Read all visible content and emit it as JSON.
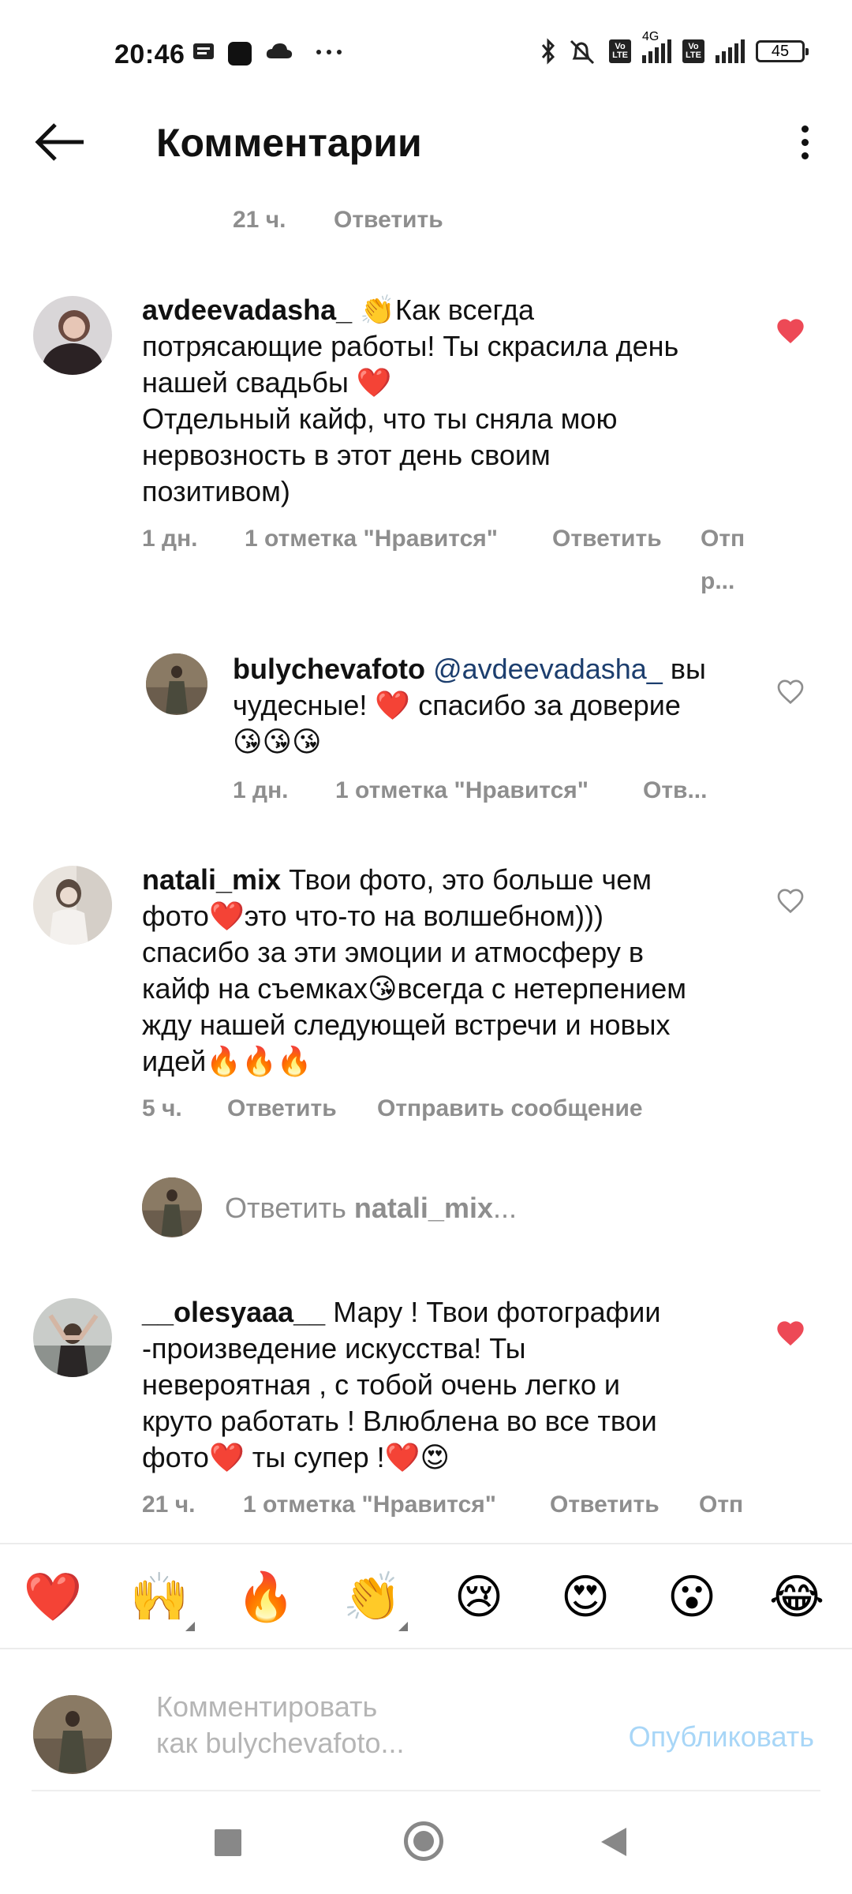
{
  "status_bar": {
    "time": "20:46",
    "battery": "45",
    "network": "4G"
  },
  "header": {
    "title": "Комментарии"
  },
  "top_meta": {
    "time": "21 ч.",
    "reply": "Ответить"
  },
  "comments": [
    {
      "username": "avdeevadasha_",
      "text": "👏Как всегда потрясающие работы! Ты скрасила день нашей свадьбы ❤️ Отдельный кайф, что ты сняла мою нервозность в этот день своим позитивом)",
      "line1": "👏Как всегда",
      "line2": "потрясающие работы! Ты скрасила день",
      "line3": "нашей свадьбы ❤️",
      "line4": "Отдельный кайф, что ты сняла мою",
      "line5": "нервозность в этот день своим",
      "line6": "позитивом)",
      "time": "1 дн.",
      "likes": "1 отметка \"Нравится\"",
      "reply": "Ответить",
      "extra_1": "Отп",
      "extra_2": "р...",
      "liked": true
    },
    {
      "username": "bulychevafoto",
      "mention": "@avdeevadasha_",
      "line1_tail": "вы",
      "line2": "чудесные! ❤️ спасибо за доверие",
      "line3": "😘😘😘",
      "time": "1 дн.",
      "likes": "1 отметка \"Нравится\"",
      "extra": "Отв...",
      "liked": false
    },
    {
      "username": "natali_mix",
      "line1_tail": "Твои фото, это больше чем",
      "line2": "фото❤️это что-то на волшебном)))",
      "line3": "спасибо за эти эмоции и атмосферу в",
      "line4": "кайф на съемках😘всегда с нетерпением",
      "line5": "жду нашей следующей встречи и новых",
      "line6": "идей🔥🔥🔥",
      "time": "5 ч.",
      "reply": "Ответить",
      "send": "Отправить сообщение",
      "liked": false
    },
    {
      "username": "__olesyaaa__",
      "line1_tail": "Мару ! Твои фотографии",
      "line2": "-произведение искусства!  Ты",
      "line3": "невероятная , с тобой очень легко и",
      "line4": "круто работать ! Влюблена во все твои",
      "line5": "фото❤️ ты супер !❤️😍",
      "time": "21 ч.",
      "likes": "1 отметка \"Нравится\"",
      "reply": "Ответить",
      "extra": "Отп",
      "liked": true
    }
  ],
  "reply_prompt": {
    "prefix": "Ответить ",
    "user": "natali_mix",
    "suffix": "..."
  },
  "emoji_bar": [
    "❤️",
    "🙌",
    "🔥",
    "👏",
    "😢",
    "😍",
    "😮",
    "😂"
  ],
  "composer": {
    "placeholder": "Комментировать как bulychevafoto...",
    "publish": "Опубликовать"
  },
  "colors": {
    "like_red": "#ed4956",
    "meta_gray": "#8e8e8e",
    "publish_blue": "#a8d6f7",
    "mention_blue": "#1c3e6e"
  }
}
